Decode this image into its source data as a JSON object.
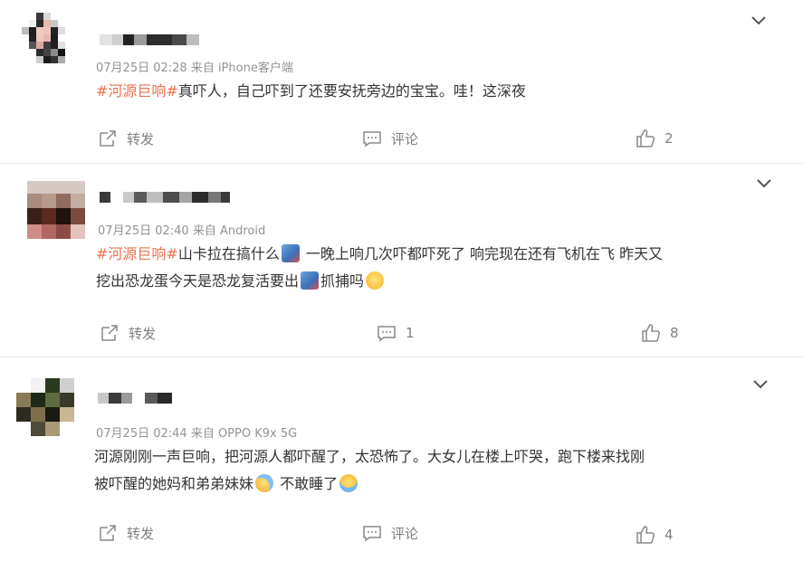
{
  "posts": [
    {
      "meta": "07月25日 02:28  来自 iPhone客户端",
      "tag": "#河源巨响#",
      "text_after_tag": "真吓人，自己吓到了还要安抚旁边的宝宝。哇！这深夜",
      "actions": {
        "repost": "转发",
        "comment": "评论",
        "likes": "2"
      }
    },
    {
      "meta": "07月25日 02:40  来自 Android",
      "tag": "#河源巨响#",
      "text_segment_1": "山卡拉在搞什么",
      "text_segment_2": " 一晚上响几次吓都吓死了 响完现在还有飞机在飞 昨天又",
      "text_line_2a": "挖出恐龙蛋今天是恐龙复活要出",
      "text_line_2b": "抓捕吗",
      "actions": {
        "repost": "转发",
        "comment": "1",
        "likes": "8"
      }
    },
    {
      "meta": "07月25日 02:44  来自 OPPO K9x 5G",
      "text_line_1": "河源刚刚一声巨响，把河源人都吓醒了，太恐怖了。大女儿在楼上吓哭，跑下楼来找刚",
      "text_line_2a": "被吓醒的她妈和弟弟妹妹",
      "text_line_2b": " 不敢睡了",
      "actions": {
        "repost": "转发",
        "comment": "评论",
        "likes": "4"
      }
    }
  ],
  "colors": {
    "tag": "#eb7350",
    "meta": "#939393",
    "action": "#808080",
    "divider": "#e6e6e6"
  },
  "icons": [
    "chevron-down-icon",
    "repost-icon",
    "comment-icon",
    "like-icon",
    "plane-emoji",
    "smile-emoji",
    "sweat-emoji",
    "cry-emoji"
  ]
}
